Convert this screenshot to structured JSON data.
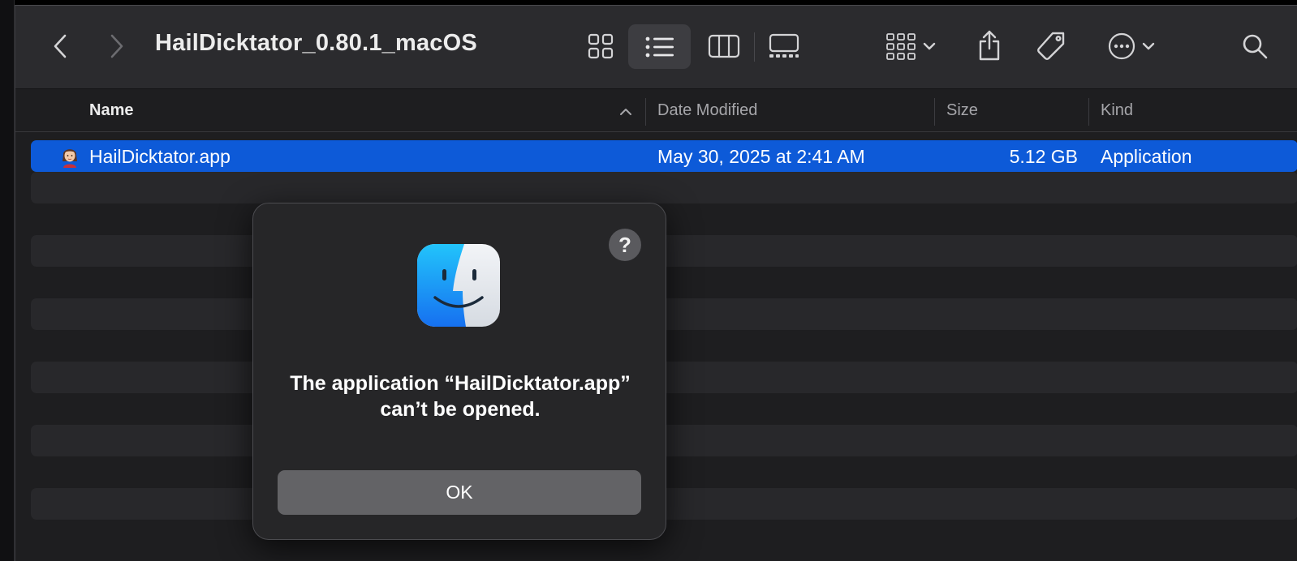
{
  "window": {
    "title": "HailDicktator_0.80.1_macOS"
  },
  "toolbar": {
    "icons": [
      "chevron-left-icon",
      "chevron-right-icon",
      "icon-view-icon",
      "list-view-icon",
      "column-view-icon",
      "gallery-view-icon",
      "group-icon",
      "share-icon",
      "tag-icon",
      "more-icon",
      "search-icon"
    ],
    "active_view": "list"
  },
  "columns": {
    "name": "Name",
    "date": "Date Modified",
    "size": "Size",
    "kind": "Kind"
  },
  "files": [
    {
      "name": "HailDicktator.app",
      "date": "May 30, 2025 at 2:41 AM",
      "size": "5.12 GB",
      "kind": "Application",
      "selected": true
    }
  ],
  "dialog": {
    "message": "The application “HailDicktator.app” can’t be opened.",
    "help_label": "?",
    "ok_label": "OK"
  },
  "colors": {
    "selection": "#0d5ad8",
    "window_bg": "#1e1e20",
    "toolbar_bg": "#2b2b2e",
    "dialog_bg": "#262628",
    "button_bg": "#636366"
  }
}
